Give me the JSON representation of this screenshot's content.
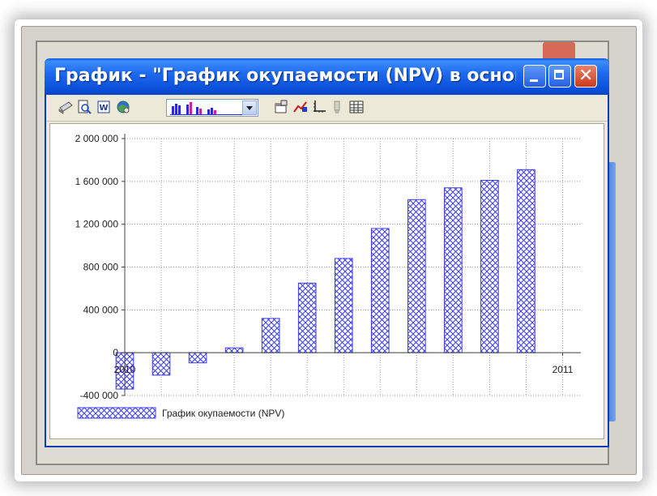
{
  "window": {
    "title": "График - \"График окупаемости (NPV) в основно...",
    "titlebar_color": "#0b4fd8"
  },
  "toolbar": {
    "icons": [
      "print-icon",
      "print-preview-icon",
      "word-export-icon",
      "web-export-icon",
      "chart-type-combo",
      "properties-icon",
      "series-style-icon",
      "axes-icon",
      "eraser-icon",
      "data-table-icon"
    ]
  },
  "chart_data": {
    "type": "bar",
    "title": "",
    "xlabel": "",
    "ylabel": "",
    "x_tick_labels": [
      "2010",
      "2011"
    ],
    "y_ticks": [
      "2 000 000",
      "1 600 000",
      "1 200 000",
      "800 000",
      "400 000",
      "0",
      "-400 000"
    ],
    "y_tick_values": [
      2000000,
      1600000,
      1200000,
      800000,
      400000,
      0,
      -400000
    ],
    "ylim": [
      -400000,
      2000000
    ],
    "grid": true,
    "legend_position": "bottom-left",
    "series": [
      {
        "name": "График окупаемости (NPV)",
        "color": "#3a3af0",
        "pattern": "crosshatch",
        "values": [
          -340000,
          -210000,
          -95000,
          45000,
          320000,
          650000,
          880000,
          1160000,
          1430000,
          1540000,
          1610000,
          1710000
        ]
      }
    ]
  }
}
